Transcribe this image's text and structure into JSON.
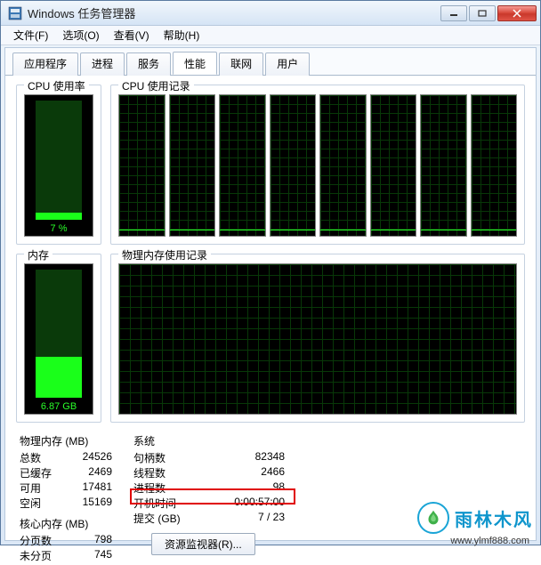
{
  "window": {
    "title": "Windows 任务管理器"
  },
  "menu": {
    "file": "文件(F)",
    "options": "选项(O)",
    "view": "查看(V)",
    "help": "帮助(H)"
  },
  "tabs": {
    "apps": "应用程序",
    "processes": "进程",
    "services": "服务",
    "performance": "性能",
    "network": "联网",
    "users": "用户"
  },
  "cpu": {
    "usage_title": "CPU 使用率",
    "history_title": "CPU 使用记录",
    "value": "7 %"
  },
  "memory": {
    "usage_title": "内存",
    "history_title": "物理内存使用记录",
    "value": "6.87 GB"
  },
  "phys_mem": {
    "title": "物理内存 (MB)",
    "total_label": "总数",
    "total": "24526",
    "cached_label": "已缓存",
    "cached": "2469",
    "avail_label": "可用",
    "avail": "17481",
    "free_label": "空闲",
    "free": "15169"
  },
  "kernel_mem": {
    "title": "核心内存 (MB)",
    "paged_label": "分页数",
    "paged": "798",
    "nonpaged_label": "未分页",
    "nonpaged": "745"
  },
  "system": {
    "title": "系统",
    "handles_label": "句柄数",
    "handles": "82348",
    "threads_label": "线程数",
    "threads": "2466",
    "processes_label": "进程数",
    "processes": "98",
    "uptime_label": "开机时间",
    "uptime": "0:00:57:00",
    "commit_label": "提交 (GB)",
    "commit": "7 / 23"
  },
  "buttons": {
    "resource_monitor": "资源监视器(R)..."
  },
  "watermark": {
    "text": "雨林木风",
    "url": "www.ylmf888.com"
  }
}
